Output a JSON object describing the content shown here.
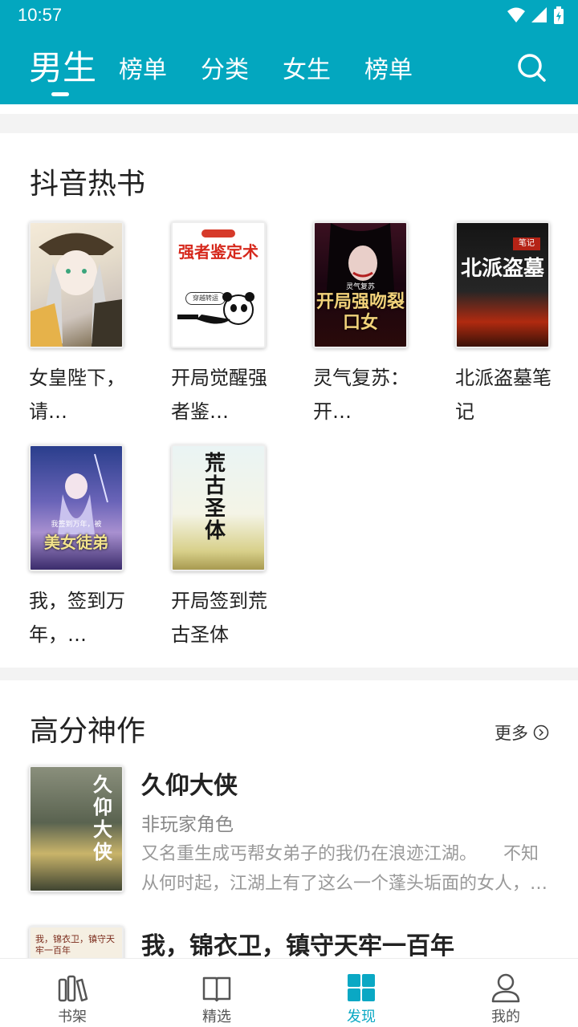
{
  "status": {
    "time": "10:57"
  },
  "tabs": [
    {
      "label": "男生",
      "active": true
    },
    {
      "label": "榜单"
    },
    {
      "label": "分类"
    },
    {
      "label": "女生"
    },
    {
      "label": "榜单"
    }
  ],
  "hot": {
    "title": "抖音热书",
    "books": [
      {
        "title": "女皇陛下，请…"
      },
      {
        "title": "开局觉醒强者鉴…",
        "cover_text": "强者鉴定术",
        "cover_small": "穿越转运"
      },
      {
        "title": "灵气复苏：开…",
        "cover_text": "开局强吻裂口女",
        "cover_small": "灵气复苏"
      },
      {
        "title": "北派盗墓笔记",
        "cover_text": "北派盗墓",
        "cover_small": "笔记"
      },
      {
        "title": "我，签到万年，…",
        "cover_text": "美女徒弟",
        "cover_small": "我签到万年，被"
      },
      {
        "title": "开局签到荒古圣体",
        "cover_text": "荒古圣体"
      }
    ]
  },
  "top": {
    "title": "高分神作",
    "more": "更多",
    "books": [
      {
        "title": "久仰大侠",
        "author": "非玩家角色",
        "desc": "又名重生成丐帮女弟子的我仍在浪迹江湖。　　不知从何时起，江湖上有了这么一个蓬头垢面的女人，…",
        "cover_text": "久仰大侠"
      },
      {
        "title": "我，锦衣卫，镇守天牢一百年",
        "cover_text": "我，锦衣卫，镇守天牢一百年"
      }
    ]
  },
  "nav": [
    {
      "label": "书架",
      "icon": "bookshelf-icon"
    },
    {
      "label": "精选",
      "icon": "book-open-icon"
    },
    {
      "label": "发现",
      "icon": "grid-icon",
      "active": true
    },
    {
      "label": "我的",
      "icon": "user-icon"
    }
  ],
  "colors": {
    "primary": "#03a7bf",
    "accent": "#0aa8c4"
  }
}
